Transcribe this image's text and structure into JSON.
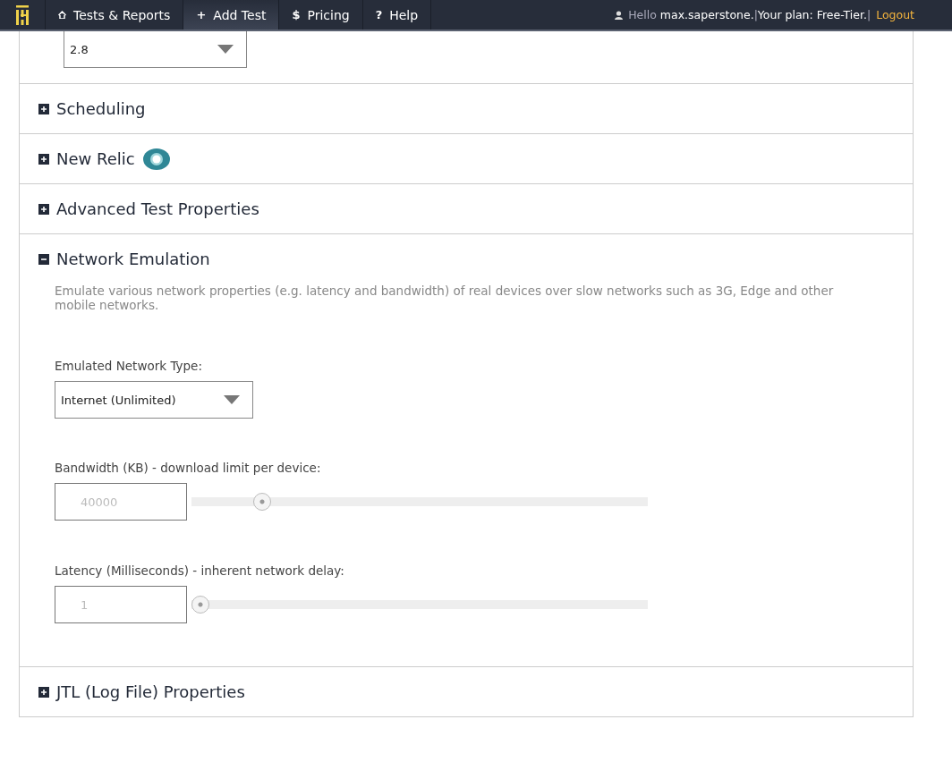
{
  "nav": {
    "items": [
      {
        "kind": "home",
        "label": "Tests & Reports",
        "selected": false
      },
      {
        "kind": "glyph",
        "icon": "+",
        "label": "Add Test",
        "selected": true
      },
      {
        "kind": "glyph",
        "icon": "$",
        "label": "Pricing",
        "selected": false
      },
      {
        "kind": "glyph",
        "icon": "?",
        "label": "Help",
        "selected": false
      }
    ],
    "user": {
      "greeting": "Hello",
      "username": "max.saperstone.",
      "separator_1": "|",
      "plan": "Your plan: Free-Tier.",
      "separator_2": "|",
      "logout": "Logout"
    }
  },
  "version_select": {
    "value": "2.8"
  },
  "sections": [
    {
      "kind": "plain",
      "title": "Scheduling",
      "expanded": false
    },
    {
      "kind": "logo",
      "title": "New Relic",
      "expanded": false
    },
    {
      "kind": "plain",
      "title": "Advanced Test Properties",
      "expanded": false
    },
    {
      "kind": "plain",
      "title": "Network Emulation",
      "expanded": true,
      "description": "Emulate various network properties (e.g. latency and bandwidth) of real devices over slow networks such as 3G, Edge and other mobile networks.",
      "network_type": {
        "label": "Emulated Network Type:",
        "value": "Internet (Unlimited)"
      },
      "sliders": [
        {
          "label": "Bandwidth (KB) - download limit per device:",
          "value": "40000",
          "level": 0.14
        },
        {
          "label": "Latency (Milliseconds) - inherent network delay:",
          "value": "1",
          "level": 0.0
        }
      ]
    },
    {
      "kind": "plain",
      "title": "JTL (Log File) Properties",
      "expanded": false
    }
  ]
}
